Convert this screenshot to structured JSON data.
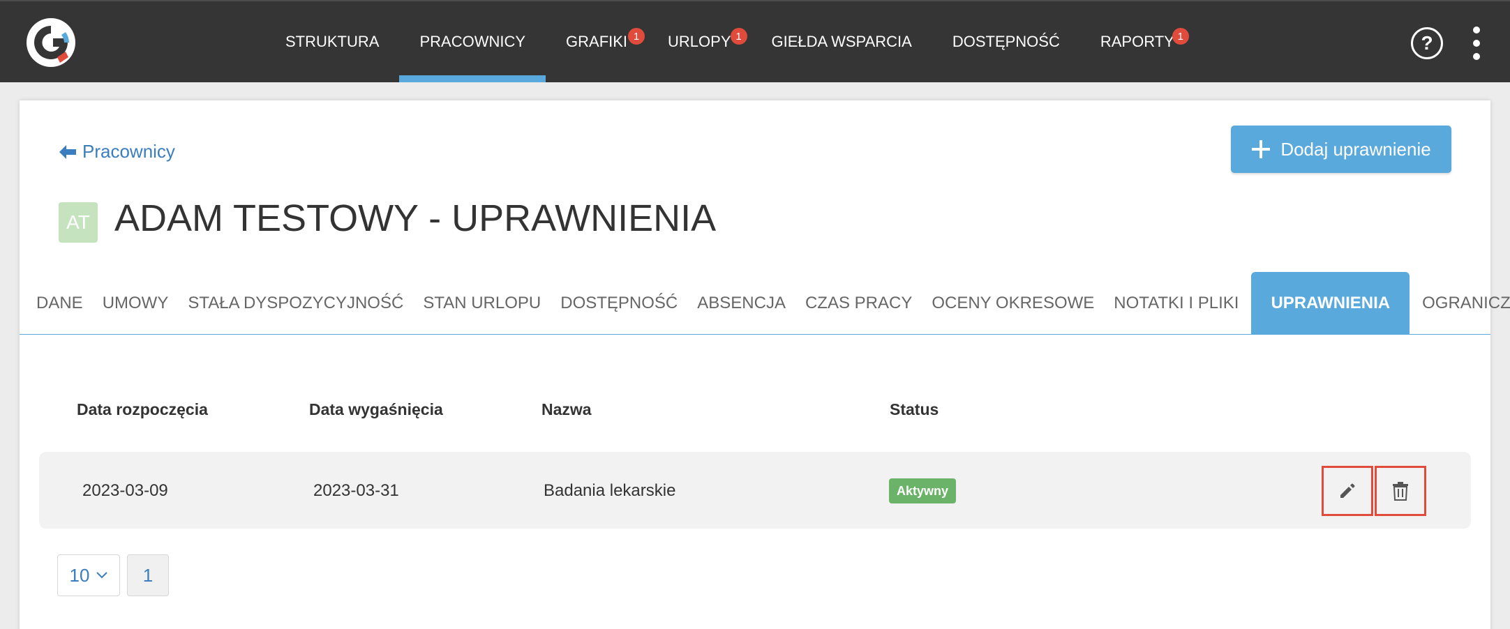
{
  "nav": {
    "items": [
      {
        "label": "STRUKTURA",
        "badge": null,
        "active": false
      },
      {
        "label": "PRACOWNICY",
        "badge": null,
        "active": true
      },
      {
        "label": "GRAFIKI",
        "badge": "1",
        "active": false
      },
      {
        "label": "URLOPY",
        "badge": "1",
        "active": false
      },
      {
        "label": "GIEŁDA WSPARCIA",
        "badge": null,
        "active": false
      },
      {
        "label": "DOSTĘPNOŚĆ",
        "badge": null,
        "active": false
      },
      {
        "label": "RAPORTY",
        "badge": "1",
        "active": false
      }
    ],
    "help_label": "?"
  },
  "header": {
    "back_label": "Pracownicy",
    "add_button_label": "Dodaj uprawnienie",
    "avatar_initials": "AT",
    "title": "ADAM TESTOWY - UPRAWNIENIA"
  },
  "tabs": [
    {
      "label": "DANE",
      "active": false
    },
    {
      "label": "UMOWY",
      "active": false
    },
    {
      "label": "STAŁA DYSPOZYCYJNOŚĆ",
      "active": false
    },
    {
      "label": "STAN URLOPU",
      "active": false
    },
    {
      "label": "DOSTĘPNOŚĆ",
      "active": false
    },
    {
      "label": "ABSENCJA",
      "active": false
    },
    {
      "label": "CZAS PRACY",
      "active": false
    },
    {
      "label": "OCENY OKRESOWE",
      "active": false
    },
    {
      "label": "NOTATKI I PLIKI",
      "active": false
    },
    {
      "label": "UPRAWNIENIA",
      "active": true
    },
    {
      "label": "OGRANICZENIA",
      "active": false
    }
  ],
  "table": {
    "columns": [
      "Data rozpoczęcia",
      "Data wygaśnięcia",
      "Nazwa",
      "Status"
    ],
    "rows": [
      {
        "start": "2023-03-09",
        "end": "2023-03-31",
        "name": "Badania lekarskie",
        "status": "Aktywny"
      }
    ]
  },
  "pagination": {
    "page_size": "10",
    "current_page": "1"
  },
  "colors": {
    "topbar": "#353535",
    "accent": "#5aa9dc",
    "badge": "#e04b3b",
    "status_active": "#6ab368",
    "highlight_border": "#e04b3b"
  },
  "icons": {
    "back": "arrow-left-icon",
    "add": "plus-icon",
    "edit": "pencil-icon",
    "delete": "trash-icon",
    "help": "question-circle-icon",
    "menu": "dots-vertical-icon",
    "select": "chevron-down-icon"
  }
}
